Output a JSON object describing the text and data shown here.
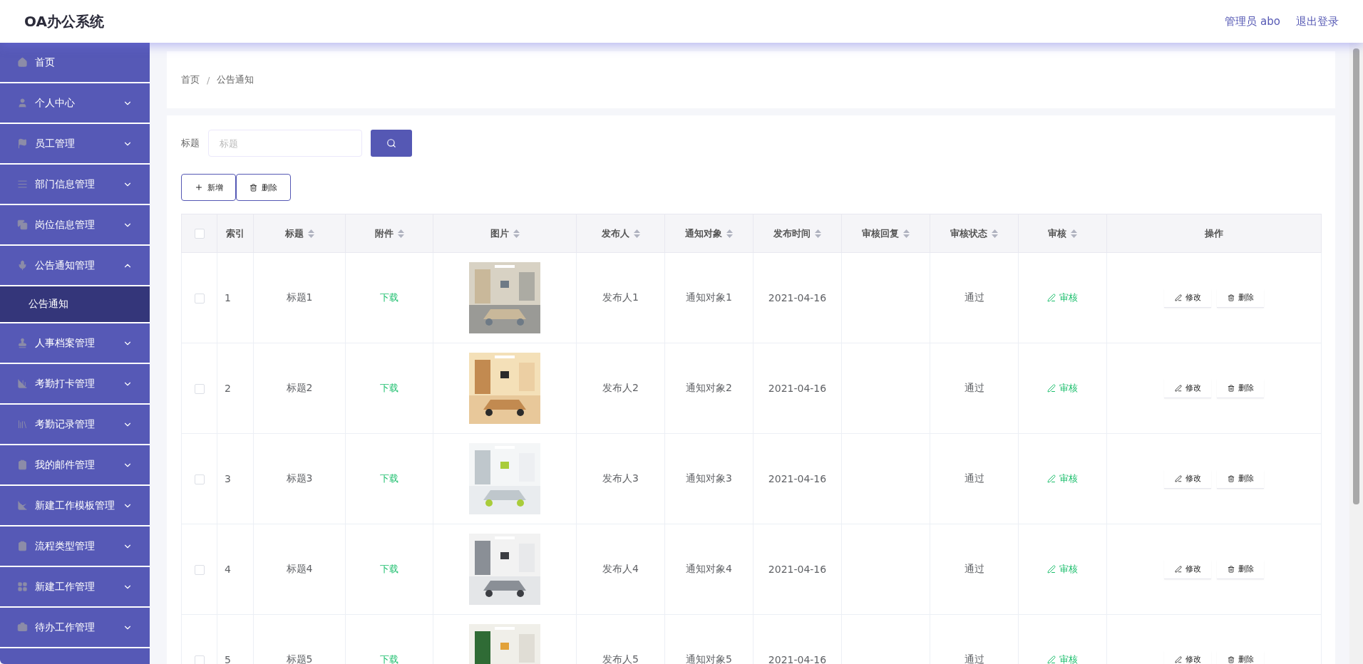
{
  "header": {
    "title": "OA办公系统",
    "user": "管理员 abo",
    "logout": "退出登录"
  },
  "sidebar": {
    "items": [
      {
        "label": "首页",
        "kind": "link",
        "selected": false
      },
      {
        "label": "个人中心",
        "kind": "group",
        "expanded": false,
        "selected": false
      },
      {
        "label": "员工管理",
        "kind": "group",
        "expanded": false,
        "selected": false
      },
      {
        "label": "部门信息管理",
        "kind": "group",
        "expanded": false,
        "selected": false
      },
      {
        "label": "岗位信息管理",
        "kind": "group",
        "expanded": false,
        "selected": false
      },
      {
        "label": "公告通知管理",
        "kind": "group",
        "expanded": true,
        "selected": false,
        "children": [
          {
            "label": "公告通知",
            "selected": true
          }
        ]
      },
      {
        "label": "人事档案管理",
        "kind": "group",
        "expanded": false,
        "selected": false
      },
      {
        "label": "考勤打卡管理",
        "kind": "group",
        "expanded": false,
        "selected": false
      },
      {
        "label": "考勤记录管理",
        "kind": "group",
        "expanded": false,
        "selected": false
      },
      {
        "label": "我的邮件管理",
        "kind": "group",
        "expanded": false,
        "selected": false
      },
      {
        "label": "新建工作模板管理",
        "kind": "group",
        "expanded": false,
        "selected": false
      },
      {
        "label": "流程类型管理",
        "kind": "group",
        "expanded": false,
        "selected": false
      },
      {
        "label": "新建工作管理",
        "kind": "group",
        "expanded": false,
        "selected": false
      },
      {
        "label": "待办工作管理",
        "kind": "group",
        "expanded": false,
        "selected": false
      }
    ]
  },
  "breadcrumb": [
    "首页",
    "公告通知"
  ],
  "breadcrumb_separator": "/",
  "search": {
    "label": "标题",
    "placeholder": "标题"
  },
  "toolbar": {
    "add": "新增",
    "delete": "删除"
  },
  "table": {
    "columns": [
      {
        "label": "索引",
        "sortable": false
      },
      {
        "label": "标题",
        "sortable": true
      },
      {
        "label": "附件",
        "sortable": true
      },
      {
        "label": "图片",
        "sortable": true
      },
      {
        "label": "发布人",
        "sortable": true
      },
      {
        "label": "通知对象",
        "sortable": true
      },
      {
        "label": "发布时间",
        "sortable": true
      },
      {
        "label": "审核回复",
        "sortable": true
      },
      {
        "label": "审核状态",
        "sortable": true
      },
      {
        "label": "审核",
        "sortable": true
      },
      {
        "label": "操作",
        "sortable": false
      }
    ],
    "all_checked": false,
    "rows": [
      {
        "checked": false,
        "index": "1",
        "title": "标题1",
        "attachment": "下载",
        "publisher": "发布人1",
        "target": "通知对象1",
        "date": "2021-04-16",
        "status": "通过",
        "review": "审核",
        "edit": "修改",
        "delete": "删除"
      },
      {
        "checked": false,
        "index": "2",
        "title": "标题2",
        "attachment": "下载",
        "publisher": "发布人2",
        "target": "通知对象2",
        "date": "2021-04-16",
        "status": "通过",
        "review": "审核",
        "edit": "修改",
        "delete": "删除"
      },
      {
        "checked": false,
        "index": "3",
        "title": "标题3",
        "attachment": "下载",
        "publisher": "发布人3",
        "target": "通知对象3",
        "date": "2021-04-16",
        "status": "通过",
        "review": "审核",
        "edit": "修改",
        "delete": "删除"
      },
      {
        "checked": false,
        "index": "4",
        "title": "标题4",
        "attachment": "下载",
        "publisher": "发布人4",
        "target": "通知对象4",
        "date": "2021-04-16",
        "status": "通过",
        "review": "审核",
        "edit": "修改",
        "delete": "删除"
      },
      {
        "checked": false,
        "index": "5",
        "title": "标题5",
        "attachment": "下载",
        "publisher": "发布人5",
        "target": "通知对象5",
        "date": "2021-04-16",
        "status": "通过",
        "review": "审核",
        "edit": "修改",
        "delete": "删除"
      }
    ]
  }
}
